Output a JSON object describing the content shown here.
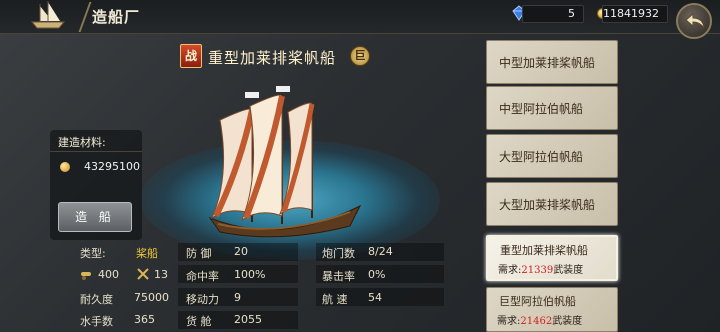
{
  "header": {
    "title": "造船厂"
  },
  "resources": {
    "gems": "5",
    "gold": "11841932"
  },
  "ship": {
    "badge": "战",
    "name": "重型加莱排桨帆船",
    "size_badge": "巨"
  },
  "materials": {
    "title": "建造材料:",
    "gold_cost": "43295100",
    "build_label": "造 船"
  },
  "stats": {
    "type_label": "类型:",
    "type_value": "桨船",
    "crew_icon_value": "400",
    "guns_icon_value": "13",
    "durability_label": "耐久度",
    "durability_value": "75000",
    "sailors_label": "水手数",
    "sailors_value": "365",
    "defense_label": "防 御",
    "defense_value": "20",
    "accuracy_label": "命中率",
    "accuracy_value": "100%",
    "mobility_label": "移动力",
    "mobility_value": "9",
    "cargo_label": "货 舱",
    "cargo_value": "2055",
    "cannon_ports_label": "炮门数",
    "cannon_ports_value": "8/24",
    "crit_label": "暴击率",
    "crit_value": "0%",
    "speed_label": "航 速",
    "speed_value": "54"
  },
  "ship_list": [
    {
      "label": "中型加莱排桨帆船"
    },
    {
      "label": "中型阿拉伯帆船"
    },
    {
      "label": "大型阿拉伯帆船"
    },
    {
      "label": "大型加莱排桨帆船"
    },
    {
      "label": "重型加莱排桨帆船",
      "req_prefix": "需求:",
      "req_value": "21339",
      "req_suffix": "武装度",
      "selected": true
    },
    {
      "label": "巨型阿拉伯帆船",
      "req_prefix": "需求:",
      "req_value": "21462",
      "req_suffix": "武装度"
    }
  ],
  "colors": {
    "accent_red": "#d01e1e",
    "panel_bg": "#2b2f32",
    "gold": "#c98a1a"
  },
  "icons": [
    "ship-logo-icon",
    "gem-icon",
    "gold-coin-icon",
    "back-arrow-icon",
    "cannon-icon",
    "crossed-swords-icon"
  ]
}
